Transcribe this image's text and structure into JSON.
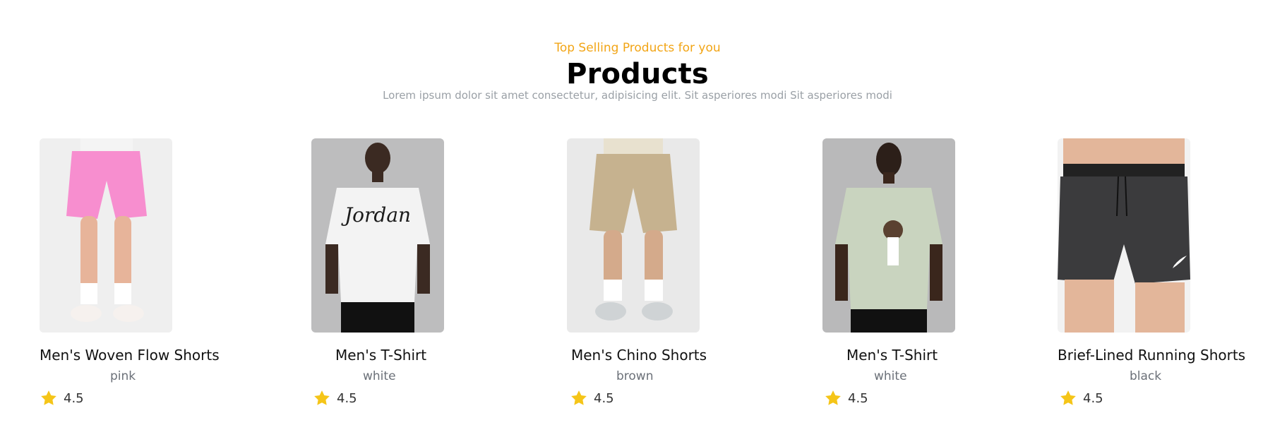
{
  "header": {
    "eyebrow": "Top Selling Products for you",
    "title": "Products",
    "description": "Lorem ipsum dolor sit amet consectetur, adipisicing elit. Sit asperiores modi Sit asperiores modi"
  },
  "colors": {
    "accent": "#f2a516",
    "star": "#f5c518",
    "muted": "#9aa0a6"
  },
  "products": [
    {
      "name": "Men's Woven Flow Shorts",
      "color": "pink",
      "rating": "4.5"
    },
    {
      "name": "Men's T-Shirt",
      "color": "white",
      "rating": "4.5"
    },
    {
      "name": "Men's Chino Shorts",
      "color": "brown",
      "rating": "4.5"
    },
    {
      "name": "Men's T-Shirt",
      "color": "white",
      "rating": "4.5"
    },
    {
      "name": "Brief-Lined Running Shorts",
      "color": "black",
      "rating": "4.5"
    }
  ]
}
